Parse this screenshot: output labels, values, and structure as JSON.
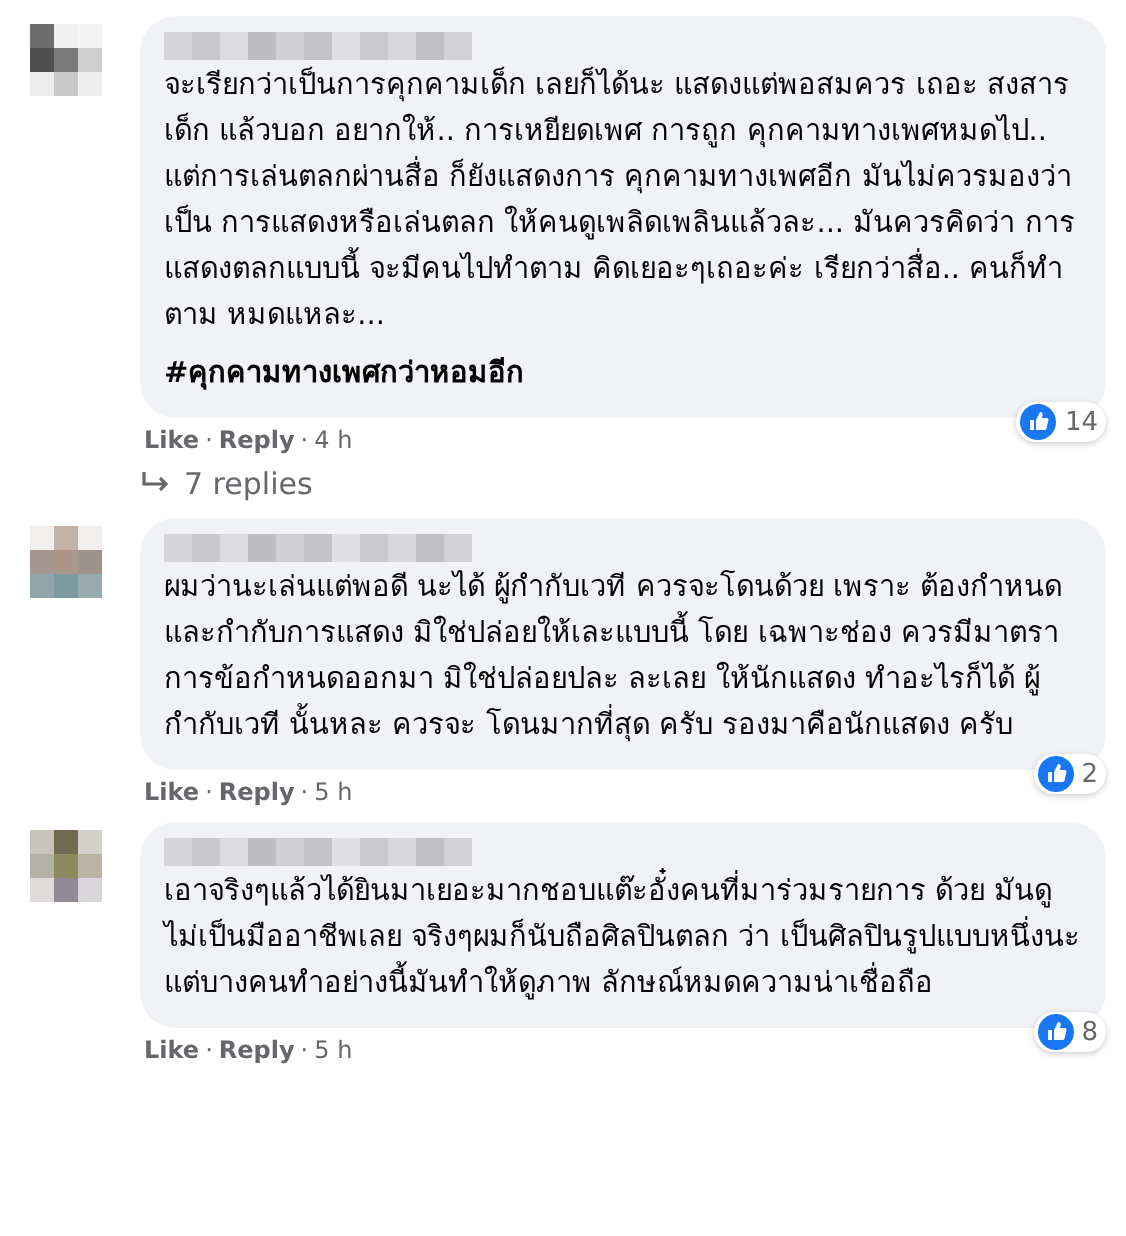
{
  "comments": [
    {
      "text": "จะเรียกว่าเป็นการคุกคามเด็ก เลยก็ได้นะ แสดงแต่พอสมควร เถอะ สงสารเด็ก แล้วบอก อยากให้.. การเหยียดเพศ การถูก คุกคามทางเพศหมดไป.. แต่การเล่นตลกผ่านสื่อ ก็ยังแสดงการ คุกคามทางเพศอีก มันไม่ควรมองว่าเป็น การแสดงหรือเล่นตลก ให้คนดูเพลิดเพลินแล้วละ... มันควรคิดว่า การแสดงตลกแบบนี้ จะมีคนไปทำตาม คิดเยอะๆเถอะค่ะ เรียกว่าสื่อ.. คนก็ทำตาม หมดแหละ...",
      "hashtag": "#คุกคามทางเพศกว่าหอมอีก",
      "likes": "14",
      "like": "Like",
      "reply": "Reply",
      "time": "4 h",
      "sep1": "·",
      "sep2": "·",
      "replies": "7 replies"
    },
    {
      "text": "ผมว่านะเล่นแต่พอดี นะได้ ผู้กำกับเวที ควรจะโดนด้วย เพราะ ต้องกำหนดและกำกับการแสดง มิใช่ปล่อยให้เละแบบนี้ โดย เฉพาะช่อง ควรมีมาตราการข้อกำหนดออกมา มิใช่ปล่อยปละ ละเลย ให้นักแสดง ทำอะไรก็ได้ ผู้กำกับเวที นั้นหละ ควรจะ โดนมากที่สุด ครับ รองมาคือนักแสดง ครับ",
      "likes": "2",
      "like": "Like",
      "reply": "Reply",
      "time": "5 h",
      "sep1": "·",
      "sep2": "·"
    },
    {
      "text": "เอาจริงๆแล้วได้ยินมาเยอะมากชอบแต๊ะอั๋งคนที่มาร่วมรายการ ด้วย มันดูไม่เป็นมืออาชีพเลย จริงๆผมก็นับถือศิลปินตลก ว่า เป็นศิลปินรูปแบบหนึ่งนะ แต่บางคนทำอย่างนี้มันทำให้ดูภาพ ลักษณ์หมดความน่าเชื่อถือ",
      "likes": "8",
      "like": "Like",
      "reply": "Reply",
      "time": "5 h",
      "sep1": "·",
      "sep2": "·"
    }
  ]
}
